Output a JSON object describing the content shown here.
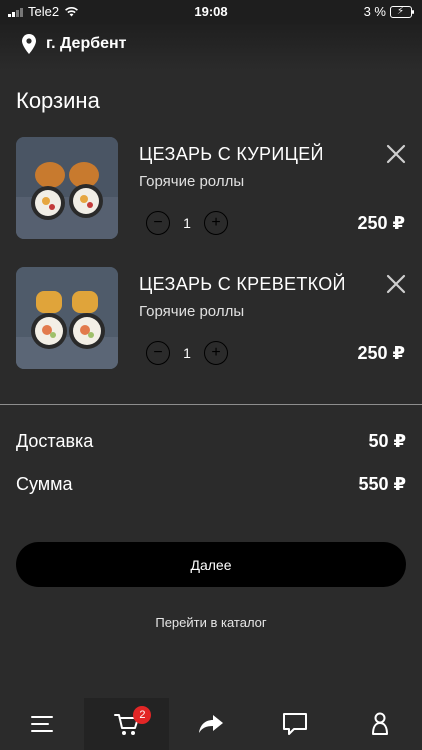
{
  "status_bar": {
    "carrier": "Tele2",
    "time": "19:08",
    "battery": "3 %"
  },
  "header": {
    "city": "г. Дербент"
  },
  "page": {
    "title": "Корзина"
  },
  "cart": {
    "items": [
      {
        "name": "ЦЕЗАРЬ С КУРИЦЕЙ",
        "category": "Горячие роллы",
        "quantity": "1",
        "price": "250 ₽"
      },
      {
        "name": "ЦЕЗАРЬ С КРЕВЕТКОЙ",
        "category": "Горячие роллы",
        "quantity": "1",
        "price": "250 ₽"
      }
    ]
  },
  "summary": {
    "delivery_label": "Доставка",
    "delivery_value": "50 ₽",
    "total_label": "Сумма",
    "total_value": "550 ₽"
  },
  "actions": {
    "next_label": "Далее",
    "catalog_link": "Перейти в каталог"
  },
  "tabbar": {
    "cart_badge": "2"
  },
  "colors": {
    "background": "#2b2b2b",
    "button": "#000000",
    "badge": "#e32626",
    "divider": "#8e8e8e"
  }
}
